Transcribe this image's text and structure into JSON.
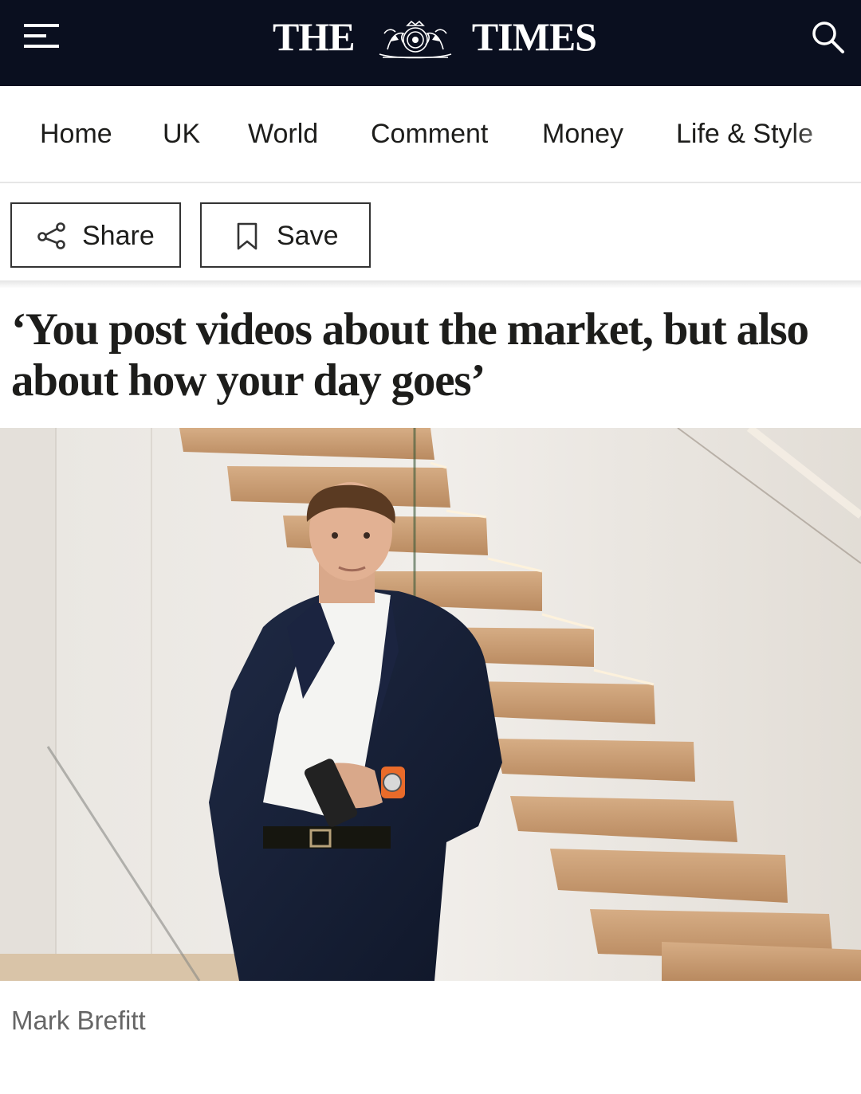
{
  "masthead": {
    "logo_left": "THE",
    "logo_right": "TIMES",
    "menu_icon": "hamburger-menu-icon",
    "search_icon": "search-icon",
    "background": "#0a0f1f"
  },
  "nav": {
    "items": [
      {
        "label": "Home"
      },
      {
        "label": "UK"
      },
      {
        "label": "World"
      },
      {
        "label": "Comment"
      },
      {
        "label": "Money"
      },
      {
        "label": "Life & Style"
      }
    ]
  },
  "actions": {
    "share_label": "Share",
    "share_icon": "share-icon",
    "save_label": "Save",
    "save_icon": "bookmark-icon"
  },
  "article": {
    "headline": "‘You post videos about the market, but also about how your day goes’",
    "photo_caption": "Mark Brefitt"
  }
}
